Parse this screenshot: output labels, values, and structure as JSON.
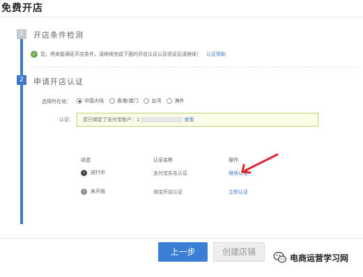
{
  "page": {
    "title": "免费开店"
  },
  "steps": [
    {
      "number": "1",
      "title": "开店条件检测"
    },
    {
      "number": "2",
      "title": "申请开店认证"
    }
  ],
  "check": {
    "icon": "check-circle-icon",
    "message": "您，将来能满足开店条件，请继续完成下面的开店认证以及验证后请继续！",
    "link": "认证帮助"
  },
  "location": {
    "label": "选择所在地：",
    "options": [
      "中国大陆",
      "香港/澳门",
      "台湾",
      "海外"
    ],
    "selected": "中国大陆"
  },
  "auth": {
    "label": "认证：",
    "message_prefix": "您已绑定了支付宝账户：1",
    "link": "查看"
  },
  "table": {
    "headers": {
      "status": "状态",
      "name": "认证名称",
      "action": "操作"
    },
    "rows": [
      {
        "status": "进行中",
        "status_icon": "info-circle-icon",
        "name": "支付宝实名认证",
        "action": "继续认证"
      },
      {
        "status": "未开始",
        "status_icon": "pending-circle-icon",
        "name": "淘宝开店认证",
        "action": "立即认证"
      }
    ]
  },
  "annotation": {
    "icon": "red-arrow-icon",
    "color": "#e0242f"
  },
  "buttons": {
    "prev": "上一步",
    "create": "创建店铺"
  },
  "watermark": {
    "icon": "wechat-icon",
    "text": "电商运营学习网"
  },
  "colors": {
    "accent": "#3f78c8",
    "success": "#69a84a",
    "auth_border": "#b9d46a"
  }
}
